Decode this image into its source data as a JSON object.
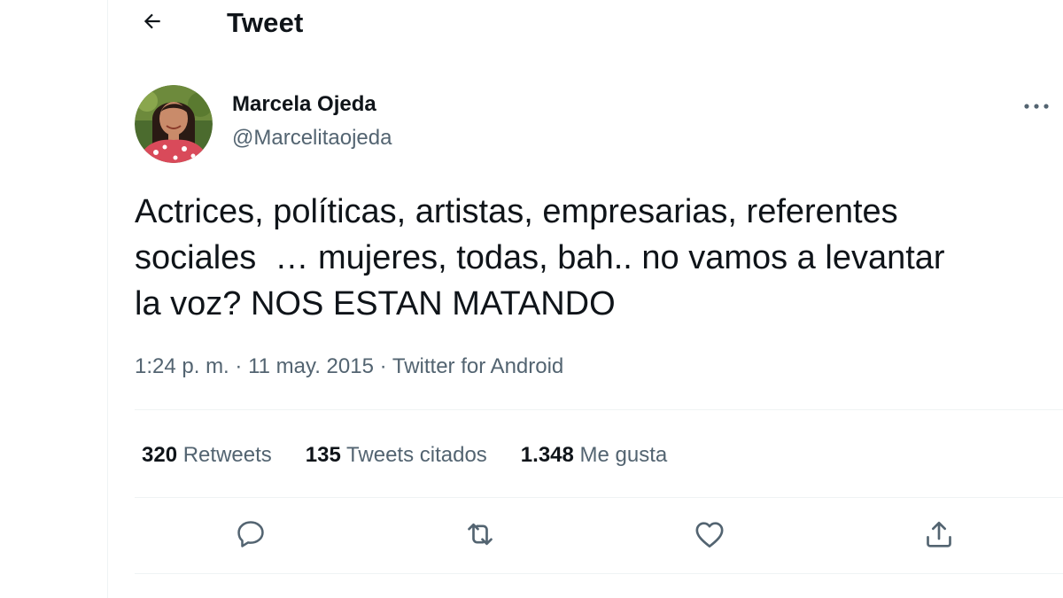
{
  "header": {
    "title": "Tweet",
    "back_icon": "arrow-left-icon"
  },
  "author": {
    "display_name": "Marcela Ojeda",
    "handle": "@Marcelitaojeda",
    "avatar": "avatar-photo"
  },
  "tweet": {
    "text": "Actrices, políticas, artistas, empresarias, referentes\nsociales  … mujeres, todas, bah.. no vamos a levantar\nla voz? NOS ESTAN MATANDO",
    "time": "1:24 p. m.",
    "separator": "·",
    "date": "11 may. 2015",
    "source": "Twitter for Android"
  },
  "stats": {
    "retweets_count": "320",
    "retweets_label": "Retweets",
    "quotes_count": "135",
    "quotes_label": "Tweets citados",
    "likes_count": "1.348",
    "likes_label": "Me gusta"
  },
  "actions": {
    "reply_icon": "reply-icon",
    "retweet_icon": "retweet-icon",
    "like_icon": "heart-icon",
    "share_icon": "share-icon"
  },
  "colors": {
    "text_primary": "#0f1419",
    "text_secondary": "#536471",
    "divider": "#eff3f4"
  }
}
